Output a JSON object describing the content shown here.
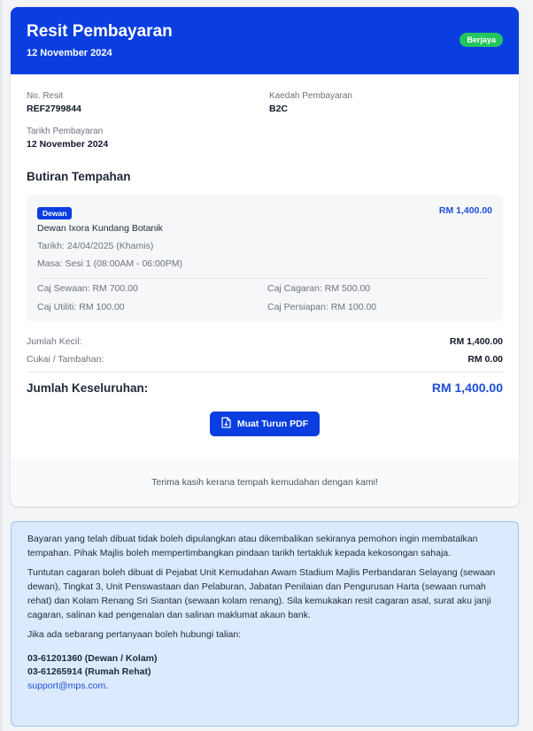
{
  "header": {
    "title": "Resit Pembayaran",
    "date": "12 November 2024",
    "status": "Berjaya",
    "bg_color": "#0a3ee0",
    "status_color": "#22c55e"
  },
  "info": {
    "receipt_no_label": "No. Resit",
    "receipt_no": "REF2799844",
    "method_label": "Kaedah Pembayaran",
    "method": "B2C",
    "paid_date_label": "Tarikh Pembayaran",
    "paid_date": "12 November 2024"
  },
  "booking": {
    "section_title": "Butiran Tempahan",
    "type": "Dewan",
    "amount": "RM 1,400.00",
    "name": "Dewan Ixora Kundang Botanik",
    "date": "Tarikh: 24/04/2025 (Khamis)",
    "session": "Masa: Sesi 1 (08:00AM - 06:00PM)",
    "fees": {
      "rental": "Caj Sewaan: RM 700.00",
      "deposit": "Caj Cagaran: RM 500.00",
      "utility": "Caj Utiliti: RM 100.00",
      "prep": "Caj Persiapan: RM 100.00"
    }
  },
  "totals": {
    "subtotal_label": "Jumlah Kecil:",
    "subtotal": "RM 1,400.00",
    "tax_label": "Cukai / Tambahan:",
    "tax": "RM 0.00",
    "grand_label": "Jumlah Keseluruhan:",
    "grand": "RM 1,400.00"
  },
  "download_button": "Muat Turun PDF",
  "footer_text": "Terima kasih kerana tempah kemudahan dengan kami!",
  "notice": {
    "p1": "Bayaran yang telah dibuat tidak boleh dipulangkan atau dikembalikan sekiranya pemohon ingin membatalkan tempahan. Pihak Majlis boleh mempertimbangkan pindaan tarikh tertakluk kepada kekosongan sahaja.",
    "p2": "Tuntutan cagaran boleh dibuat di Pejabat Unit Kemudahan Awam Stadium Majlis Perbandaran Selayang (sewaan dewan), Tingkat 3, Unit Penswastaan dan Pelaburan, Jabatan Penilaian dan Pengurusan Harta (sewaan rumah rehat) dan Kolam Renang Sri Siantan (sewaan kolam renang). Sila kemukakan resit cagaran asal, surat aku janji cagaran, salinan kad pengenalan dan salinan maklumat akaun bank.",
    "p3": "Jika ada sebarang pertanyaan boleh hubungi talian:",
    "phone1": "03-61201360 (Dewan / Kolam)",
    "phone2": "03-61265914 (Rumah Rehat)",
    "email": "support@mps.com",
    "email_suffix": "."
  }
}
